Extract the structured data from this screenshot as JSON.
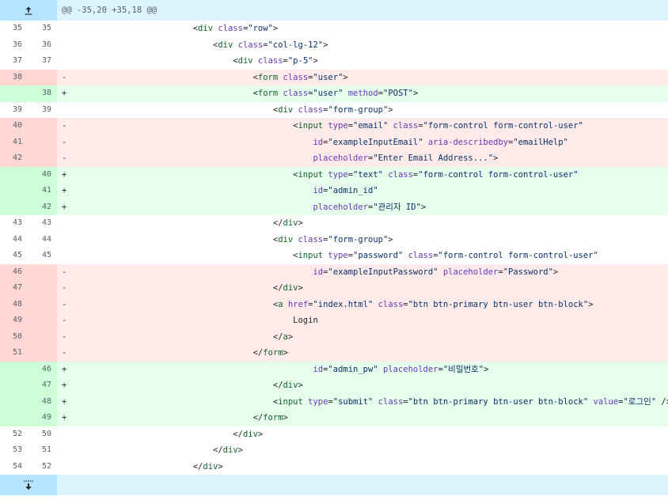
{
  "hunk_header": "@@ -35,20 +35,18 @@",
  "lines": [
    {
      "t": "ctx",
      "old": "35",
      "new": "35",
      "m": " ",
      "i": "                        ",
      "tk": [
        [
          "p",
          "<"
        ],
        [
          "tag",
          "div"
        ],
        [
          "p",
          " "
        ],
        [
          "attr",
          "class"
        ],
        [
          "p",
          "="
        ],
        [
          "str",
          "\"row\""
        ],
        [
          "p",
          ">"
        ]
      ]
    },
    {
      "t": "ctx",
      "old": "36",
      "new": "36",
      "m": " ",
      "i": "                            ",
      "tk": [
        [
          "p",
          "<"
        ],
        [
          "tag",
          "div"
        ],
        [
          "p",
          " "
        ],
        [
          "attr",
          "class"
        ],
        [
          "p",
          "="
        ],
        [
          "str",
          "\"col-lg-12\""
        ],
        [
          "p",
          ">"
        ]
      ]
    },
    {
      "t": "ctx",
      "old": "37",
      "new": "37",
      "m": " ",
      "i": "                                ",
      "tk": [
        [
          "p",
          "<"
        ],
        [
          "tag",
          "div"
        ],
        [
          "p",
          " "
        ],
        [
          "attr",
          "class"
        ],
        [
          "p",
          "="
        ],
        [
          "str",
          "\"p-5\""
        ],
        [
          "p",
          ">"
        ]
      ]
    },
    {
      "t": "del",
      "old": "38",
      "new": "",
      "m": "-",
      "i": "                                    ",
      "tk": [
        [
          "p",
          "<"
        ],
        [
          "tag",
          "form"
        ],
        [
          "p",
          " "
        ],
        [
          "attr",
          "class"
        ],
        [
          "p",
          "="
        ],
        [
          "str",
          "\"user\""
        ],
        [
          "p",
          ">"
        ]
      ]
    },
    {
      "t": "add",
      "old": "",
      "new": "38",
      "m": "+",
      "i": "                                    ",
      "tk": [
        [
          "p",
          "<"
        ],
        [
          "tag",
          "form"
        ],
        [
          "p",
          " "
        ],
        [
          "attr",
          "class"
        ],
        [
          "p",
          "="
        ],
        [
          "str",
          "\"user\""
        ],
        [
          "p",
          " "
        ],
        [
          "attr",
          "method"
        ],
        [
          "p",
          "="
        ],
        [
          "str",
          "\"POST\""
        ],
        [
          "p",
          ">"
        ]
      ]
    },
    {
      "t": "ctx",
      "old": "39",
      "new": "39",
      "m": " ",
      "i": "                                        ",
      "tk": [
        [
          "p",
          "<"
        ],
        [
          "tag",
          "div"
        ],
        [
          "p",
          " "
        ],
        [
          "attr",
          "class"
        ],
        [
          "p",
          "="
        ],
        [
          "str",
          "\"form-group\""
        ],
        [
          "p",
          ">"
        ]
      ]
    },
    {
      "t": "del",
      "old": "40",
      "new": "",
      "m": "-",
      "i": "                                            ",
      "tk": [
        [
          "p",
          "<"
        ],
        [
          "tag",
          "input"
        ],
        [
          "p",
          " "
        ],
        [
          "attr",
          "type"
        ],
        [
          "p",
          "="
        ],
        [
          "str",
          "\"email\""
        ],
        [
          "p",
          " "
        ],
        [
          "attr",
          "class"
        ],
        [
          "p",
          "="
        ],
        [
          "str",
          "\"form-control form-control-user\""
        ]
      ]
    },
    {
      "t": "del",
      "old": "41",
      "new": "",
      "m": "-",
      "i": "                                                ",
      "tk": [
        [
          "attr",
          "id"
        ],
        [
          "p",
          "="
        ],
        [
          "str",
          "\"exampleInputEmail\""
        ],
        [
          "p",
          " "
        ],
        [
          "attr",
          "aria-describedby"
        ],
        [
          "p",
          "="
        ],
        [
          "str",
          "\"emailHelp\""
        ]
      ]
    },
    {
      "t": "del",
      "old": "42",
      "new": "",
      "m": "-",
      "i": "                                                ",
      "tk": [
        [
          "attr",
          "placeholder"
        ],
        [
          "p",
          "="
        ],
        [
          "str",
          "\"Enter Email Address...\""
        ],
        [
          "p",
          ">"
        ]
      ]
    },
    {
      "t": "add",
      "old": "",
      "new": "40",
      "m": "+",
      "i": "                                            ",
      "tk": [
        [
          "p",
          "<"
        ],
        [
          "tag",
          "input"
        ],
        [
          "p",
          " "
        ],
        [
          "attr",
          "type"
        ],
        [
          "p",
          "="
        ],
        [
          "str",
          "\"text\""
        ],
        [
          "p",
          " "
        ],
        [
          "attr",
          "class"
        ],
        [
          "p",
          "="
        ],
        [
          "str",
          "\"form-control form-control-user\""
        ]
      ]
    },
    {
      "t": "add",
      "old": "",
      "new": "41",
      "m": "+",
      "i": "                                                ",
      "tk": [
        [
          "attr",
          "id"
        ],
        [
          "p",
          "="
        ],
        [
          "str",
          "\"admin_id\""
        ]
      ]
    },
    {
      "t": "add",
      "old": "",
      "new": "42",
      "m": "+",
      "i": "                                                ",
      "tk": [
        [
          "attr",
          "placeholder"
        ],
        [
          "p",
          "="
        ],
        [
          "str",
          "\"관리자 ID\""
        ],
        [
          "p",
          ">"
        ]
      ]
    },
    {
      "t": "ctx",
      "old": "43",
      "new": "43",
      "m": " ",
      "i": "                                        ",
      "tk": [
        [
          "p",
          "</"
        ],
        [
          "tag",
          "div"
        ],
        [
          "p",
          ">"
        ]
      ]
    },
    {
      "t": "ctx",
      "old": "44",
      "new": "44",
      "m": " ",
      "i": "                                        ",
      "tk": [
        [
          "p",
          "<"
        ],
        [
          "tag",
          "div"
        ],
        [
          "p",
          " "
        ],
        [
          "attr",
          "class"
        ],
        [
          "p",
          "="
        ],
        [
          "str",
          "\"form-group\""
        ],
        [
          "p",
          ">"
        ]
      ]
    },
    {
      "t": "ctx",
      "old": "45",
      "new": "45",
      "m": " ",
      "i": "                                            ",
      "tk": [
        [
          "p",
          "<"
        ],
        [
          "tag",
          "input"
        ],
        [
          "p",
          " "
        ],
        [
          "attr",
          "type"
        ],
        [
          "p",
          "="
        ],
        [
          "str",
          "\"password\""
        ],
        [
          "p",
          " "
        ],
        [
          "attr",
          "class"
        ],
        [
          "p",
          "="
        ],
        [
          "str",
          "\"form-control form-control-user\""
        ]
      ]
    },
    {
      "t": "del",
      "old": "46",
      "new": "",
      "m": "-",
      "i": "                                                ",
      "tk": [
        [
          "attr",
          "id"
        ],
        [
          "p",
          "="
        ],
        [
          "str",
          "\"exampleInputPassword\""
        ],
        [
          "p",
          " "
        ],
        [
          "attr",
          "placeholder"
        ],
        [
          "p",
          "="
        ],
        [
          "str",
          "\"Password\""
        ],
        [
          "p",
          ">"
        ]
      ]
    },
    {
      "t": "del",
      "old": "47",
      "new": "",
      "m": "-",
      "i": "                                        ",
      "tk": [
        [
          "p",
          "</"
        ],
        [
          "tag",
          "div"
        ],
        [
          "p",
          ">"
        ]
      ]
    },
    {
      "t": "del",
      "old": "48",
      "new": "",
      "m": "-",
      "i": "                                        ",
      "tk": [
        [
          "p",
          "<"
        ],
        [
          "tag",
          "a"
        ],
        [
          "p",
          " "
        ],
        [
          "attr",
          "href"
        ],
        [
          "p",
          "="
        ],
        [
          "str",
          "\"index.html\""
        ],
        [
          "p",
          " "
        ],
        [
          "attr",
          "class"
        ],
        [
          "p",
          "="
        ],
        [
          "str",
          "\"btn btn-primary btn-user btn-block\""
        ],
        [
          "p",
          ">"
        ]
      ]
    },
    {
      "t": "del",
      "old": "49",
      "new": "",
      "m": "-",
      "i": "                                            ",
      "tk": [
        [
          "p",
          "Login"
        ]
      ]
    },
    {
      "t": "del",
      "old": "50",
      "new": "",
      "m": "-",
      "i": "                                        ",
      "tk": [
        [
          "p",
          "</"
        ],
        [
          "tag",
          "a"
        ],
        [
          "p",
          ">"
        ]
      ]
    },
    {
      "t": "del",
      "old": "51",
      "new": "",
      "m": "-",
      "i": "                                    ",
      "tk": [
        [
          "p",
          "</"
        ],
        [
          "tag",
          "form"
        ],
        [
          "p",
          ">"
        ]
      ]
    },
    {
      "t": "add",
      "old": "",
      "new": "46",
      "m": "+",
      "i": "                                                ",
      "tk": [
        [
          "attr",
          "id"
        ],
        [
          "p",
          "="
        ],
        [
          "str",
          "\"admin_pw\""
        ],
        [
          "p",
          " "
        ],
        [
          "attr",
          "placeholder"
        ],
        [
          "p",
          "="
        ],
        [
          "str",
          "\"비밀번호\""
        ],
        [
          "p",
          ">"
        ]
      ]
    },
    {
      "t": "add",
      "old": "",
      "new": "47",
      "m": "+",
      "i": "                                        ",
      "tk": [
        [
          "p",
          "</"
        ],
        [
          "tag",
          "div"
        ],
        [
          "p",
          ">"
        ]
      ]
    },
    {
      "t": "add",
      "old": "",
      "new": "48",
      "m": "+",
      "i": "                                        ",
      "tk": [
        [
          "p",
          "<"
        ],
        [
          "tag",
          "input"
        ],
        [
          "p",
          " "
        ],
        [
          "attr",
          "type"
        ],
        [
          "p",
          "="
        ],
        [
          "str",
          "\"submit\""
        ],
        [
          "p",
          " "
        ],
        [
          "attr",
          "class"
        ],
        [
          "p",
          "="
        ],
        [
          "str",
          "\"btn btn-primary btn-user btn-block\""
        ],
        [
          "p",
          " "
        ],
        [
          "attr",
          "value"
        ],
        [
          "p",
          "="
        ],
        [
          "str",
          "\"로그인\""
        ],
        [
          "p",
          " />"
        ]
      ]
    },
    {
      "t": "add",
      "old": "",
      "new": "49",
      "m": "+",
      "i": "                                    ",
      "tk": [
        [
          "p",
          "</"
        ],
        [
          "tag",
          "form"
        ],
        [
          "p",
          ">"
        ]
      ]
    },
    {
      "t": "ctx",
      "old": "52",
      "new": "50",
      "m": " ",
      "i": "                                ",
      "tk": [
        [
          "p",
          "</"
        ],
        [
          "tag",
          "div"
        ],
        [
          "p",
          ">"
        ]
      ]
    },
    {
      "t": "ctx",
      "old": "53",
      "new": "51",
      "m": " ",
      "i": "                            ",
      "tk": [
        [
          "p",
          "</"
        ],
        [
          "tag",
          "div"
        ],
        [
          "p",
          ">"
        ]
      ]
    },
    {
      "t": "ctx",
      "old": "54",
      "new": "52",
      "m": " ",
      "i": "                        ",
      "tk": [
        [
          "p",
          "</"
        ],
        [
          "tag",
          "div"
        ],
        [
          "p",
          ">"
        ]
      ]
    }
  ],
  "colors": {
    "deleted_bg": "#ffebe9",
    "added_bg": "#e6ffec",
    "hunk_bg": "#ddf4ff",
    "accent": "#0969da"
  },
  "icons": {
    "expand_up": "expand-up-icon",
    "expand_down": "expand-down-icon"
  }
}
